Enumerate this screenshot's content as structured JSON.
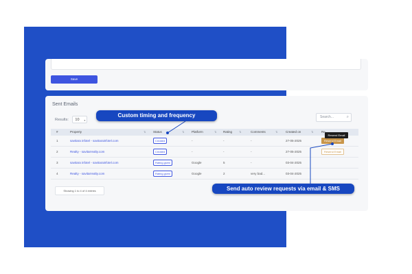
{
  "top_form": {
    "save_label": "Save"
  },
  "card": {
    "title": "Sent Emails"
  },
  "results": {
    "label": "Results:",
    "value": "10"
  },
  "search": {
    "placeholder": "Search..."
  },
  "table": {
    "columns": [
      "#",
      "Property",
      "Status",
      "Platform",
      "Rating",
      "Comments",
      "Created on",
      "Re"
    ],
    "rows": [
      {
        "num": "1",
        "property": "savitara infotel - savitarainfotel.com",
        "status": "Created",
        "platform": "-",
        "rating": "-",
        "comments": "-",
        "created": "27-05-2025",
        "action": "Resend Email",
        "action_style": "primary"
      },
      {
        "num": "2",
        "property": "Realty - savitarrealty.com",
        "status": "Created",
        "platform": "-",
        "rating": "-",
        "comments": "-",
        "created": "27-05-2025",
        "action": "Resend Email",
        "action_style": "outline"
      },
      {
        "num": "3",
        "property": "savitara infotel - savitarainfotel.com",
        "status": "Rating given",
        "platform": "Google",
        "rating": "5",
        "comments": "-",
        "created": "03-04-2025",
        "action": "",
        "action_style": ""
      },
      {
        "num": "4",
        "property": "Realty - savitarrealty.com",
        "status": "Rating given",
        "platform": "Google",
        "rating": "2",
        "comments": "very bad...",
        "created": "03-04-2025",
        "action": "",
        "action_style": ""
      }
    ]
  },
  "tooltip": {
    "text": "Resend Email"
  },
  "pagination": {
    "info": "Showing 1 to 4 of 4 entries"
  },
  "callouts": {
    "timing": "Custom timing and frequency",
    "requests": "Send auto review requests via email & SMS"
  },
  "colors": {
    "brand_blue": "#1f4fc6",
    "callout_blue": "#1747c0",
    "primary_button": "#3e55e0",
    "action_gold": "#c9964a"
  }
}
